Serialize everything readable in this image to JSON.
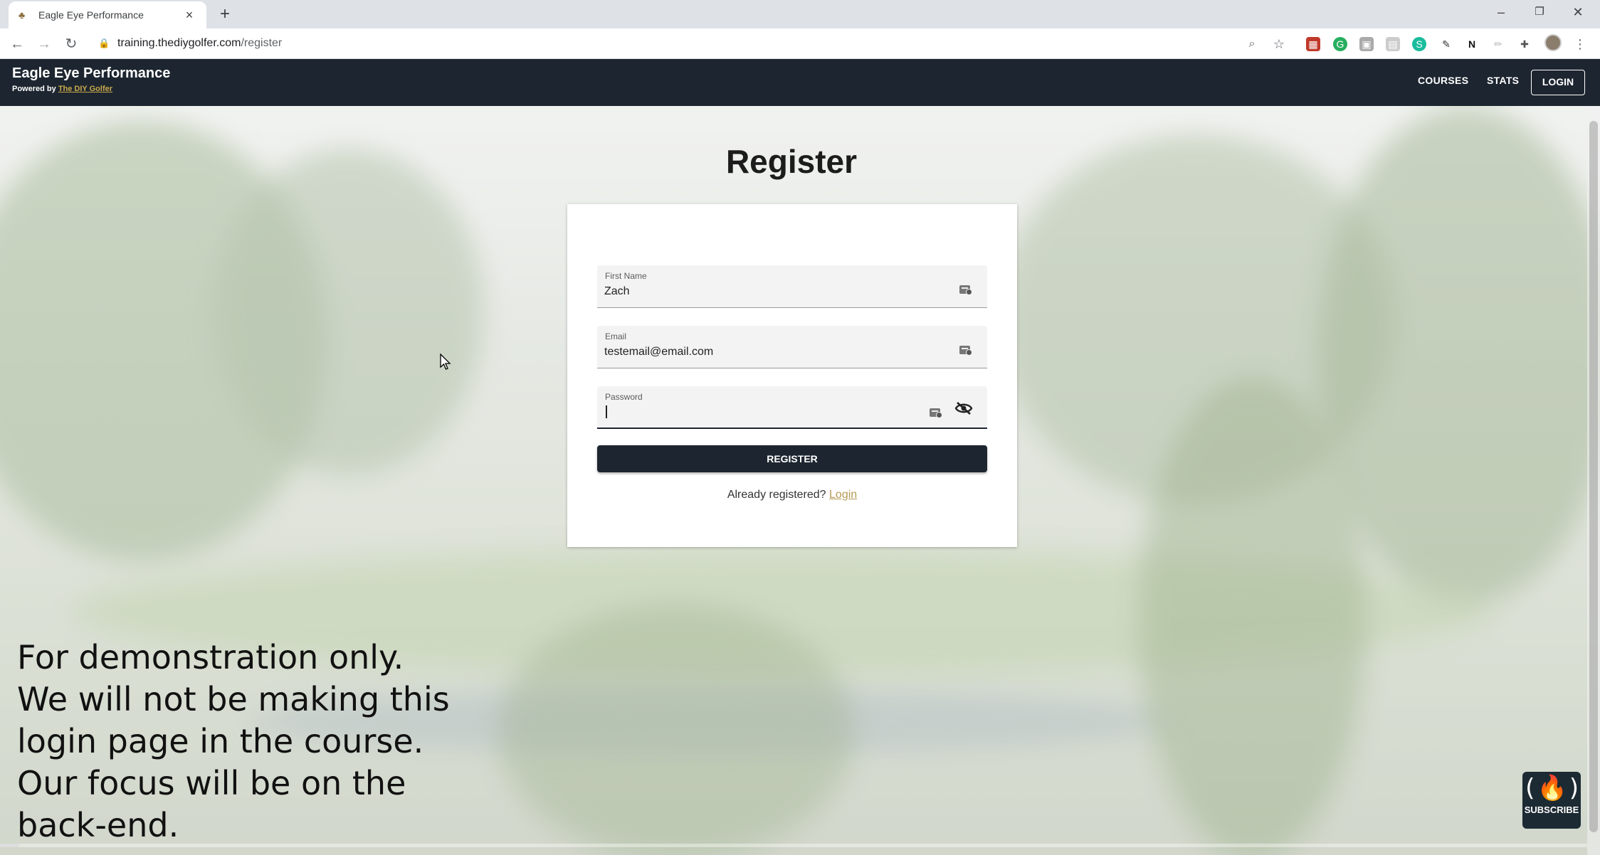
{
  "browser": {
    "tab_title": "Eagle Eye Performance",
    "new_tab_icon": "plus-icon",
    "url_host": "training.thediygolfer.com",
    "url_path": "/register",
    "window_controls": [
      "minimize-icon",
      "restore-icon",
      "close-icon"
    ]
  },
  "nav": {
    "brand_title": "Eagle Eye Performance",
    "powered_by": "Powered by",
    "powered_link": "The DIY Golfer",
    "links": [
      "COURSES",
      "STATS",
      "LOGIN"
    ]
  },
  "page": {
    "title": "Register"
  },
  "form": {
    "first_name_label": "First Name",
    "first_name_value": "Zach",
    "email_label": "Email",
    "email_value": "testemail@email.com",
    "password_label": "Password",
    "password_value": "",
    "register_label": "REGISTER",
    "already_text": "Already registered?",
    "login_link": "Login"
  },
  "caption": {
    "lines": [
      "For demonstration only.",
      "We will not be making this",
      "login page in the course.",
      "Our focus will be on the",
      "back-end."
    ]
  },
  "subscribe": {
    "label": "SUBSCRIBE",
    "glyph": "(🔥)"
  },
  "video": {
    "progress": 0.012
  },
  "colors": {
    "nav_bg": "#1d2630",
    "accent_link": "#b59a55",
    "button_bg": "#1d2630"
  }
}
